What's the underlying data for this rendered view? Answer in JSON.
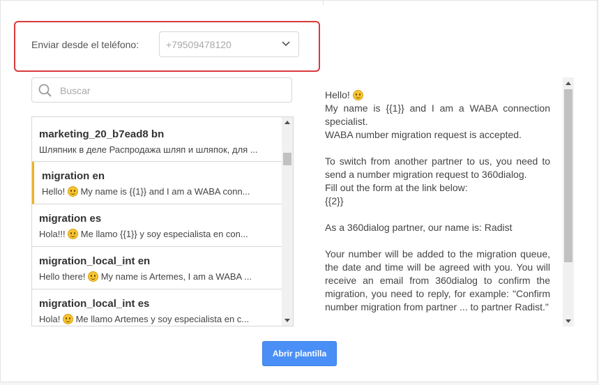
{
  "phone": {
    "label": "Enviar desde el teléfono:",
    "value": "+79509478120"
  },
  "search": {
    "placeholder": "Buscar"
  },
  "templates": [
    {
      "title": "marketing_20_b7ead8 bn",
      "preview_before": "Шляпник в деле Распродажа шляп и шляпок, для ...",
      "emoji": false,
      "preview_after": ""
    },
    {
      "title": "migration en",
      "preview_before": "Hello! ",
      "emoji": true,
      "preview_after": " My name is {{1}} and I am a WABA conn...",
      "selected": true
    },
    {
      "title": "migration es",
      "preview_before": "Hola!!! ",
      "emoji": true,
      "preview_after": " Me llamo {{1}} y soy especialista en con..."
    },
    {
      "title": "migration_local_int en",
      "preview_before": "Hello there! ",
      "emoji": true,
      "preview_after": " My name is Artemes, I am a WABA ..."
    },
    {
      "title": "migration_local_int es",
      "preview_before": "Hola! ",
      "emoji": true,
      "preview_after": " Me llamo Artemes y soy especialista en c..."
    }
  ],
  "preview": {
    "l1": "Hello! ",
    "l2": "My name is {{1}} and I am a WABA connection specialist.",
    "l3": "WABA number migration request is accepted.",
    "l4": "To switch from another partner to us, you need to send a number migration request to 360dialog.",
    "l5": "Fill out the form at the link below:",
    "l6": "{{2}}",
    "l7": "As a 360dialog partner, our name is: Radist",
    "l8": "Your number will be added to the migration queue, the date and time will be agreed with you. You will receive an email from 360dialog to confirm the migration, you need to reply, for example: \"Confirm number migration from partner ... to partner Radist.\""
  },
  "button": {
    "open_label": "Abrir plantilla"
  },
  "colors": {
    "highlight_border": "#d9393a",
    "selected_marker": "#f3b21f",
    "primary_button": "#4a8ff5"
  },
  "icons": {
    "dropdown": "chevron-down-icon",
    "search": "search-icon",
    "emoji": "smiley-emoji-icon"
  }
}
